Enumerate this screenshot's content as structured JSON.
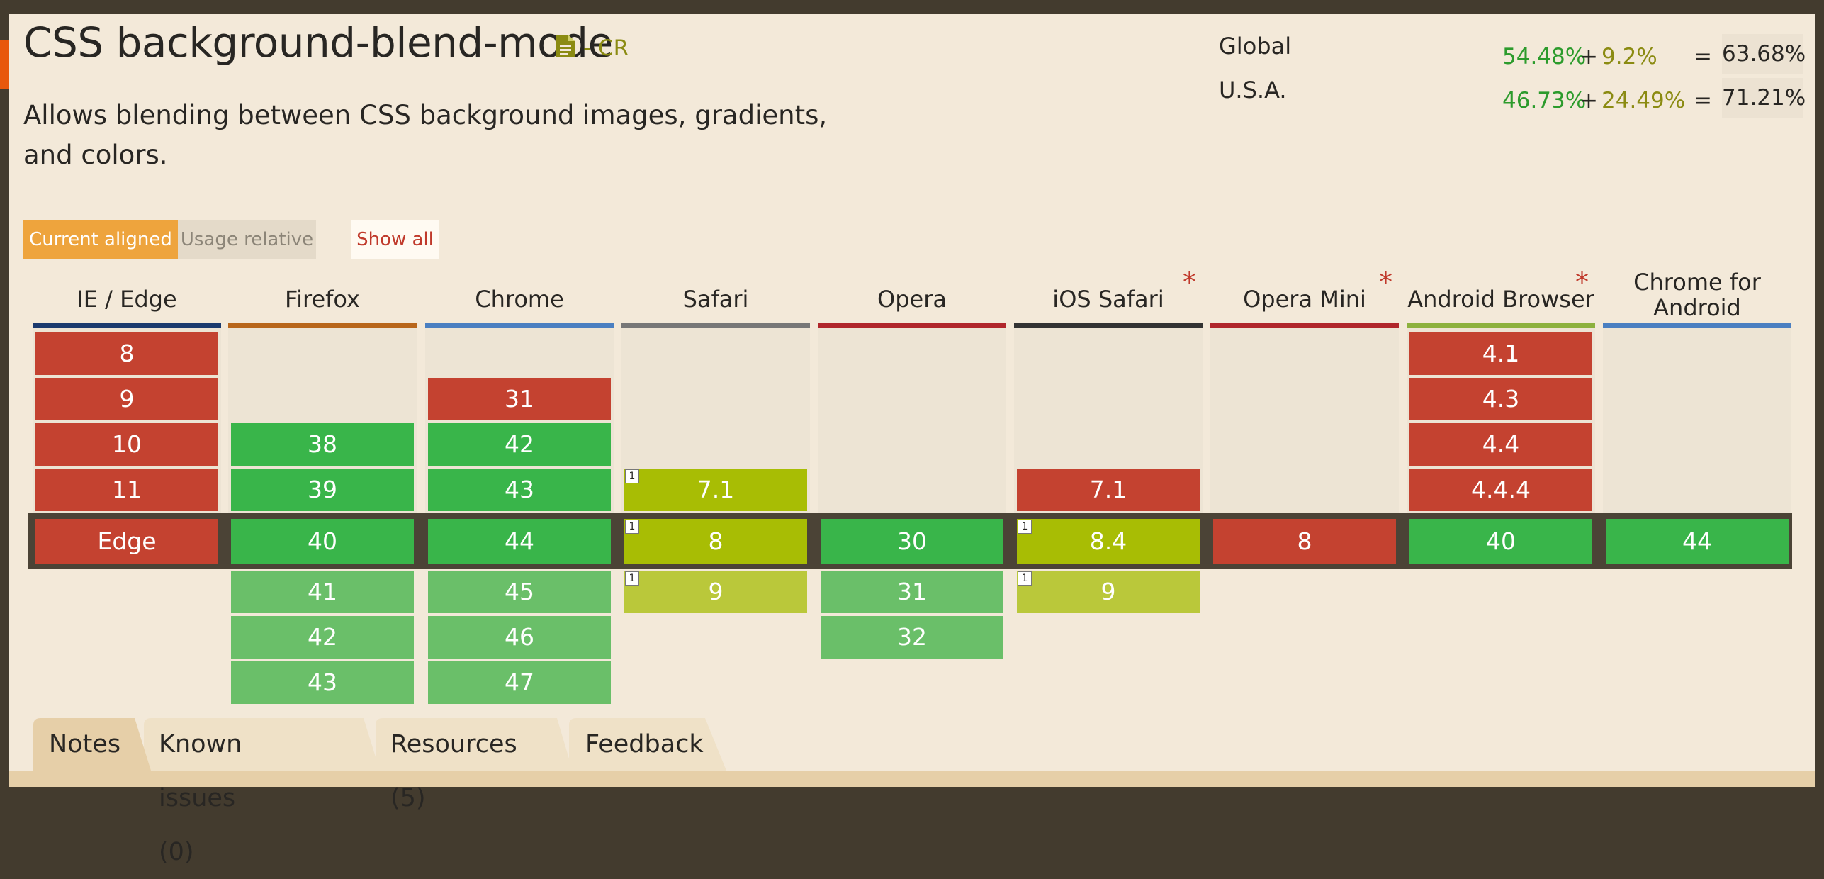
{
  "feature": {
    "title": "CSS background-blend-mode",
    "status": "- CR",
    "description": "Allows blending between CSS background images, gradients, and colors."
  },
  "stats": [
    {
      "label": "Global",
      "supported": "54.48%",
      "plus": "+",
      "partial": "9.2%",
      "equals": "=",
      "total": "63.68%"
    },
    {
      "label": "U.S.A.",
      "supported": "46.73%",
      "plus": "+",
      "partial": "24.49%",
      "equals": "=",
      "total": "71.21%"
    }
  ],
  "toolbar": {
    "current_aligned": "Current aligned",
    "usage_relative": "Usage relative",
    "show_all": "Show all"
  },
  "colors": {
    "unsupported": "#c44230",
    "supported": "#39b54a",
    "supported_future": "#6abf69",
    "partial": "#a8bd04",
    "partial_future": "#bac83a"
  },
  "browsers": [
    {
      "name": "IE / Edge",
      "bar": "#1b3a6e",
      "asterisk": false,
      "past": [
        {
          "v": "8",
          "s": "n"
        },
        {
          "v": "9",
          "s": "n"
        },
        {
          "v": "10",
          "s": "n"
        },
        {
          "v": "11",
          "s": "n"
        }
      ],
      "current": {
        "v": "Edge",
        "s": "n"
      },
      "future": []
    },
    {
      "name": "Firefox",
      "bar": "#b8661b",
      "asterisk": false,
      "past": [
        null,
        null,
        {
          "v": "38",
          "s": "y"
        },
        {
          "v": "39",
          "s": "y"
        }
      ],
      "current": {
        "v": "40",
        "s": "y"
      },
      "future": [
        {
          "v": "41",
          "s": "y"
        },
        {
          "v": "42",
          "s": "y"
        },
        {
          "v": "43",
          "s": "y"
        }
      ]
    },
    {
      "name": "Chrome",
      "bar": "#4a7fc1",
      "asterisk": false,
      "past": [
        null,
        {
          "v": "31",
          "s": "n"
        },
        {
          "v": "42",
          "s": "y"
        },
        {
          "v": "43",
          "s": "y"
        }
      ],
      "current": {
        "v": "44",
        "s": "y"
      },
      "future": [
        {
          "v": "45",
          "s": "y"
        },
        {
          "v": "46",
          "s": "y"
        },
        {
          "v": "47",
          "s": "y"
        }
      ]
    },
    {
      "name": "Safari",
      "bar": "#777777",
      "asterisk": false,
      "past": [
        null,
        null,
        null,
        {
          "v": "7.1",
          "s": "a",
          "note": "1"
        }
      ],
      "current": {
        "v": "8",
        "s": "a",
        "note": "1"
      },
      "future": [
        {
          "v": "9",
          "s": "a",
          "note": "1"
        }
      ]
    },
    {
      "name": "Opera",
      "bar": "#b0262b",
      "asterisk": false,
      "past": [
        null,
        null,
        null,
        null
      ],
      "current": {
        "v": "30",
        "s": "y"
      },
      "future": [
        {
          "v": "31",
          "s": "y"
        },
        {
          "v": "32",
          "s": "y"
        }
      ]
    },
    {
      "name": "iOS Safari",
      "bar": "#333333",
      "asterisk": true,
      "past": [
        null,
        null,
        null,
        {
          "v": "7.1",
          "s": "n"
        }
      ],
      "current": {
        "v": "8.4",
        "s": "a",
        "note": "1"
      },
      "future": [
        {
          "v": "9",
          "s": "a",
          "note": "1"
        }
      ]
    },
    {
      "name": "Opera Mini",
      "bar": "#b0262b",
      "asterisk": true,
      "past": [
        null,
        null,
        null,
        null
      ],
      "current": {
        "v": "8",
        "s": "n"
      },
      "future": []
    },
    {
      "name": "Android Browser",
      "bar": "#8db13e",
      "asterisk": true,
      "past": [
        {
          "v": "4.1",
          "s": "n"
        },
        {
          "v": "4.3",
          "s": "n"
        },
        {
          "v": "4.4",
          "s": "n"
        },
        {
          "v": "4.4.4",
          "s": "n"
        }
      ],
      "current": {
        "v": "40",
        "s": "y"
      },
      "future": []
    },
    {
      "name": "Chrome for Android",
      "bar": "#4a7fc1",
      "asterisk": false,
      "past": [
        null,
        null,
        null,
        null
      ],
      "current": {
        "v": "44",
        "s": "y"
      },
      "future": []
    }
  ],
  "tabs": [
    {
      "label": "Notes",
      "active": true
    },
    {
      "label": "Known issues (0)",
      "active": false
    },
    {
      "label": "Resources (5)",
      "active": false
    },
    {
      "label": "Feedback",
      "active": false
    }
  ]
}
